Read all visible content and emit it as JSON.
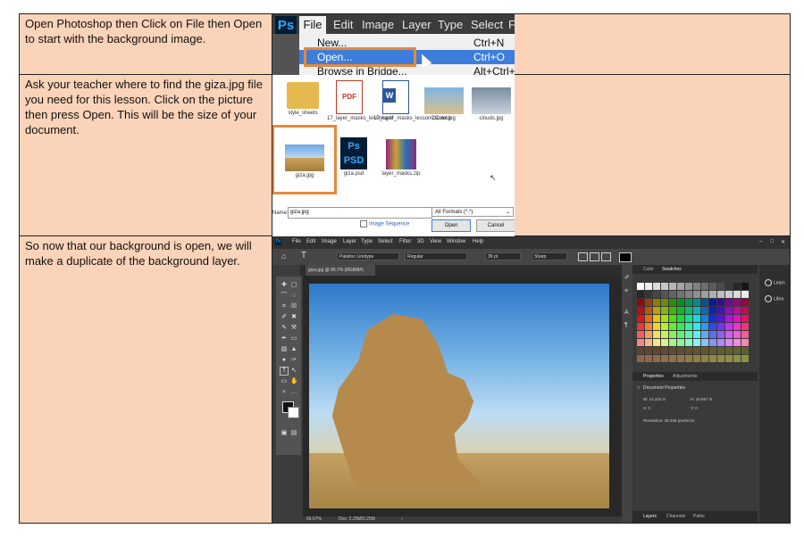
{
  "rows": [
    {
      "instruction": "Open Photoshop then Click on File then Open to start with the background image."
    },
    {
      "instruction": "Ask your teacher where to find the giza.jpg file you need for this lesson. Click on the picture then press Open. This will be the size of your document."
    },
    {
      "instruction": "So now that our background is open, we will make a duplicate of the background layer."
    }
  ],
  "file_menu_shot": {
    "logo": "Ps",
    "menus": [
      "File",
      "Edit",
      "Image",
      "Layer",
      "Type",
      "Select",
      "F"
    ],
    "items": [
      {
        "label": "New...",
        "shortcut": "Ctrl+N"
      },
      {
        "label": "Open...",
        "shortcut": "Ctrl+O"
      },
      {
        "label": "Browse in Bridge...",
        "shortcut": "Alt+Ctrl+O"
      }
    ]
  },
  "open_dialog_shot": {
    "files": [
      {
        "name": "style_sheets",
        "kind": "folder"
      },
      {
        "name": "17_layer_masks_lesson.pdf",
        "kind": "pdf",
        "badge": "PDF"
      },
      {
        "name": "17_layer_masks_lessonCC.docx",
        "kind": "word",
        "badge": "W"
      },
      {
        "name": "camel.jpg",
        "kind": "image"
      },
      {
        "name": "clouds.jpg",
        "kind": "image"
      },
      {
        "name": "giza.jpg",
        "kind": "image"
      },
      {
        "name": "giza.psd",
        "kind": "psd",
        "badge": "Ps\nPSD"
      },
      {
        "name": "layer_masks.zip",
        "kind": "zip"
      }
    ],
    "name_label": "Name:",
    "name_value": "giza.jpg",
    "format_value": "All Formats (*.*)",
    "image_sequence": "Image Sequence",
    "open_button": "Open",
    "cancel_button": "Cancel"
  },
  "workspace_shot": {
    "menus": [
      "File",
      "Edit",
      "Image",
      "Layer",
      "Type",
      "Select",
      "Filter",
      "3D",
      "View",
      "Window",
      "Help"
    ],
    "font_family": "Palatino Linotype",
    "font_style": "Regular",
    "font_size": "36 pt",
    "antialias": "Sharp",
    "doc_tab": "giza.jpg @ 66.7% (RGB/8#)",
    "zoom": "66.67%",
    "doc_size": "Doc: 2.25M/2.25M",
    "swatch_tabs": [
      "Color",
      "Swatches"
    ],
    "props_tabs": [
      "Properties",
      "Adjustments"
    ],
    "props_title": "Document Properties",
    "width": "W: 14.222 in",
    "height": "H: 10.667 in",
    "x": "X: 0",
    "y": "Y: 0",
    "resolution": "Resolution: 28.346 pixels/cm",
    "layers_tabs": [
      "Layers",
      "Channels",
      "Paths"
    ],
    "side_panel": [
      "Learn",
      "Libra"
    ]
  }
}
